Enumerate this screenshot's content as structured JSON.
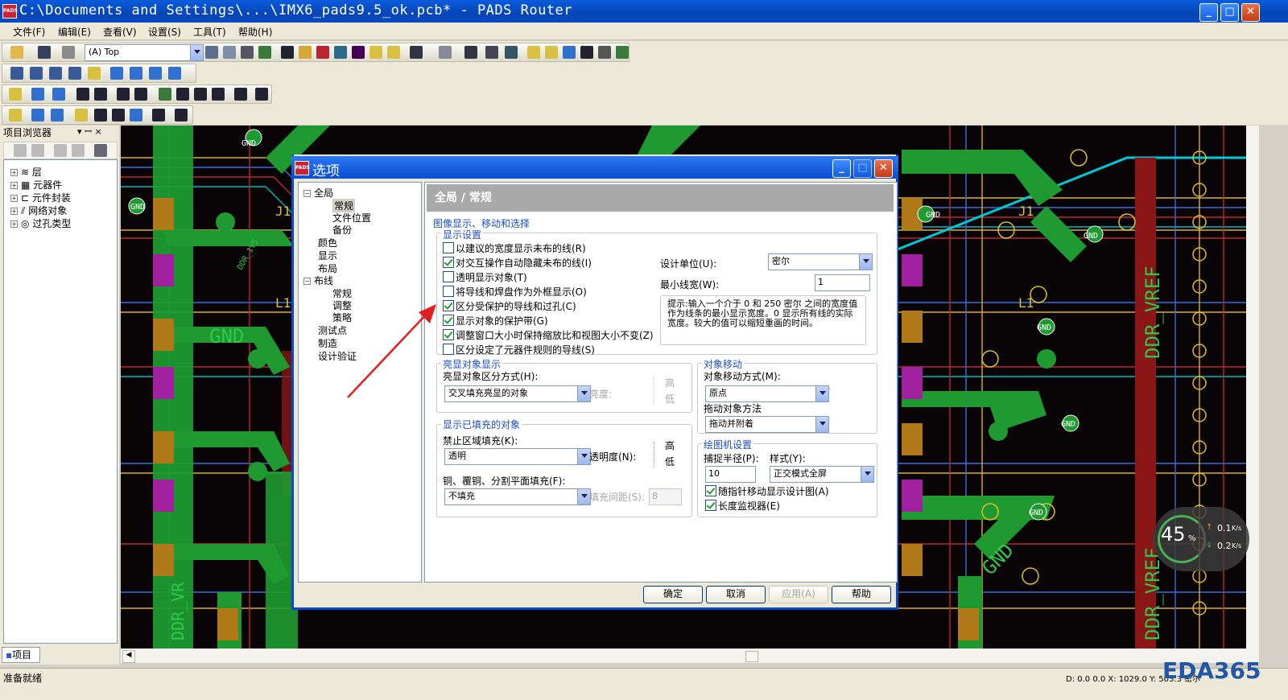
{
  "window": {
    "title": "C:\\Documents and Settings\\...\\IMX6_pads9.5_ok.pcb* - PADS Router",
    "app_icon": "PADS",
    "min_label": "_",
    "max_label": "□",
    "close_label": "✕"
  },
  "menu": [
    "文件(F)",
    "编辑(E)",
    "查看(V)",
    "设置(S)",
    "工具(T)",
    "帮助(H)"
  ],
  "toolbar": {
    "layer_combo": "(A) Top"
  },
  "project_browser": {
    "title": "项目浏览器",
    "pin": "▾ ꟷ ×",
    "items": [
      {
        "label": "层",
        "icon": "layers-icon"
      },
      {
        "label": "元器件",
        "icon": "component-icon"
      },
      {
        "label": "元件封装",
        "icon": "footprint-icon"
      },
      {
        "label": "网络对象",
        "icon": "net-icon"
      },
      {
        "label": "过孔类型",
        "icon": "via-icon"
      }
    ],
    "tab": "项目"
  },
  "status": {
    "left": "准备就绪",
    "right": "D: 0.0 0.0 X: 1029.0 Y: 503.3 密尔"
  },
  "watermark": "EDA365",
  "speed_widget": {
    "percent": "45",
    "pct_sign": "%",
    "up": "0.1",
    "up_unit": "K/s",
    "down": "0.2",
    "down_unit": "K/s"
  },
  "pcb_labels": {
    "gnd": "GND",
    "vref": "DDR_VREF",
    "vref2": "DDR_VREF",
    "j1": "J1",
    "l1": "L1",
    "ddr": "DDR_1V5",
    "ddr2": "DDR_VR",
    "gnd_big": "GND",
    "gnd_big2": "GND"
  },
  "dialog": {
    "title": "选项",
    "tree": [
      {
        "label": "全局",
        "level": 0,
        "expander": "−"
      },
      {
        "label": "常规",
        "level": 1,
        "selected": true
      },
      {
        "label": "文件位置",
        "level": 1
      },
      {
        "label": "备份",
        "level": 1
      },
      {
        "label": "颜色",
        "level": 0
      },
      {
        "label": "显示",
        "level": 0
      },
      {
        "label": "布局",
        "level": 0
      },
      {
        "label": "布线",
        "level": 0,
        "expander": "−"
      },
      {
        "label": "常规",
        "level": 1
      },
      {
        "label": "调整",
        "level": 1
      },
      {
        "label": "策略",
        "level": 1
      },
      {
        "label": "测试点",
        "level": 0
      },
      {
        "label": "制造",
        "level": 0
      },
      {
        "label": "设计验证",
        "level": 0
      }
    ],
    "panel_title": "全局 / 常规",
    "section_title": "图像显示、移动和选择",
    "display_settings": {
      "title": "显示设置",
      "checkboxes": [
        {
          "label": "以建议的宽度显示未布的线(R)",
          "checked": false
        },
        {
          "label": "对交互操作自动隐藏未布的线(I)",
          "checked": true
        },
        {
          "label": "透明显示对象(T)",
          "checked": false
        },
        {
          "label": "将导线和焊盘作为外框显示(O)",
          "checked": false
        },
        {
          "label": "区分受保护的导线和过孔(C)",
          "checked": true
        },
        {
          "label": "显示对象的保护带(G)",
          "checked": true
        },
        {
          "label": "调整窗口大小时保持缩放比和视图大小不变(Z)",
          "checked": true
        },
        {
          "label": "区分设定了元器件规则的导线(S)",
          "checked": false
        }
      ],
      "design_unit_label": "设计单位(U):",
      "design_unit_value": "密尔",
      "min_width_label": "最小线宽(W):",
      "min_width_value": "1",
      "hint": "提示:输入一个介于 0 和 250 密尔 之间的宽度值作为线条的最小显示宽度。0 显示所有线的实际宽度。较大的值可以缩短重画的时间。"
    },
    "highlight": {
      "title": "亮显对象显示",
      "mode_label": "亮显对象区分方式(H):",
      "mode_value": "交叉填充亮显的对象",
      "brightness_label": "亮度:",
      "high": "高",
      "low": "低"
    },
    "filled": {
      "title": "显示已填充的对象",
      "keepout_label": "禁止区域填充(K):",
      "keepout_value": "透明",
      "transparency_label": "透明度(N):",
      "high": "高",
      "low": "低",
      "copper_label": "铜、覆铜、分割平面填充(F):",
      "copper_value": "不填充",
      "fill_spacing_label": "填充间距(S):",
      "fill_spacing_value": "8"
    },
    "move": {
      "title": "对象移动",
      "mode_label": "对象移动方式(M):",
      "mode_value": "原点",
      "drag_label": "拖动对象方法",
      "drag_value": "拖动并附着"
    },
    "cursor": {
      "title": "绘图机设置",
      "radius_label": "捕捉半径(P):",
      "radius_value": "10",
      "style_label": "样式(Y):",
      "style_value": "正交模式全屏",
      "follow_label": "随指针移动显示设计图(A)",
      "follow_checked": true,
      "monitor_label": "长度监视器(E)",
      "monitor_checked": true
    },
    "buttons": {
      "ok": "确定",
      "cancel": "取消",
      "apply": "应用(A)",
      "help": "帮助"
    }
  }
}
